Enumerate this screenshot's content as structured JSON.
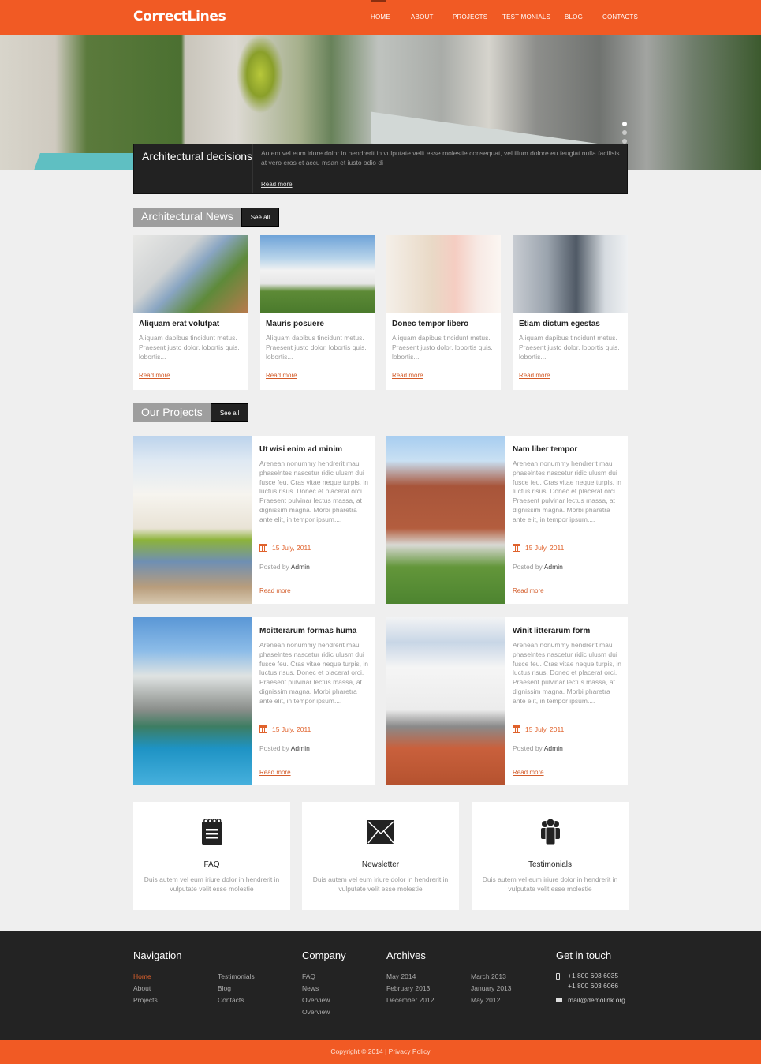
{
  "header": {
    "logo": "CorrectLines",
    "nav": [
      {
        "label": "HOME",
        "active": true
      },
      {
        "label": "ABOUT",
        "active": false
      },
      {
        "label": "PROJECTS",
        "active": false
      },
      {
        "label": "TESTIMONIALS",
        "active": false
      },
      {
        "label": "BLOG",
        "active": false
      },
      {
        "label": "CONTACTS",
        "active": false
      }
    ],
    "accent_color": "#f15a24"
  },
  "slider": {
    "title": "Architectural decisions",
    "text": "Autem vel eum iriure dolor in hendrerit in vulputate velit esse molestie consequat, vel illum dolore eu feugiat nulla facilisis at vero eros et accu msan et iusto odio di",
    "link": "Read more",
    "slide_count": 3,
    "active_slide": 1
  },
  "news": {
    "title": "Architectural News",
    "see_all": "See all",
    "items": [
      {
        "title": "Aliquam erat volutpat",
        "text": "Aliquam dapibus tincidunt metus. Praesent justo dolor, lobortis quis, lobortis...",
        "link": "Read more"
      },
      {
        "title": "Mauris posuere",
        "text": "Aliquam dapibus tincidunt metus. Praesent justo dolor, lobortis quis, lobortis...",
        "link": "Read more"
      },
      {
        "title": "Donec tempor libero",
        "text": "Aliquam dapibus tincidunt metus. Praesent justo dolor, lobortis quis, lobortis...",
        "link": "Read more"
      },
      {
        "title": "Etiam dictum egestas",
        "text": "Aliquam dapibus tincidunt metus. Praesent justo dolor, lobortis quis, lobortis...",
        "link": "Read more"
      }
    ]
  },
  "projects": {
    "title": "Our Projects",
    "see_all": "See all",
    "items": [
      {
        "title": "Ut wisi enim ad minim",
        "text": "Arenean nonummy hendrerit mau phaselntes nascetur ridic ulusm dui fusce feu. Cras vitae neque turpis, in luctus risus. Donec et placerat orci. Praesent pulvinar lectus massa, at dignissim magna. Morbi pharetra ante elit, in tempor ipsum....",
        "date": "15 July, 2011",
        "posted_by": "Posted by",
        "author": "Admin",
        "link": "Read more"
      },
      {
        "title": "Nam liber tempor",
        "text": "Arenean nonummy hendrerit mau phaselntes nascetur ridic ulusm dui fusce feu. Cras vitae neque turpis, in luctus risus. Donec et placerat orci. Praesent pulvinar lectus massa, at dignissim magna. Morbi pharetra ante elit, in tempor ipsum....",
        "date": "15 July, 2011",
        "posted_by": "Posted by",
        "author": "Admin",
        "link": "Read more"
      },
      {
        "title": "Moitterarum formas huma",
        "text": "Arenean nonummy hendrerit mau phaselntes nascetur ridic ulusm dui fusce feu. Cras vitae neque turpis, in luctus risus. Donec et placerat orci. Praesent pulvinar lectus massa, at dignissim magna. Morbi pharetra ante elit, in tempor ipsum....",
        "date": "15 July, 2011",
        "posted_by": "Posted by",
        "author": "Admin",
        "link": "Read more"
      },
      {
        "title": "Winit litterarum form",
        "text": "Arenean nonummy hendrerit mau phaselntes nascetur ridic ulusm dui fusce feu. Cras vitae neque turpis, in luctus risus. Donec et placerat orci. Praesent pulvinar lectus massa, at dignissim magna. Morbi pharetra ante elit, in tempor ipsum....",
        "date": "15 July, 2011",
        "posted_by": "Posted by",
        "author": "Admin",
        "link": "Read more"
      }
    ]
  },
  "features": [
    {
      "icon": "notepad-icon",
      "title": "FAQ",
      "text": "Duis autem vel eum iriure dolor in hendrerit in vulputate velit esse molestie"
    },
    {
      "icon": "envelope-icon",
      "title": "Newsletter",
      "text": "Duis autem vel eum iriure dolor in hendrerit in vulputate velit esse molestie"
    },
    {
      "icon": "people-icon",
      "title": "Testimonials",
      "text": "Duis autem vel eum iriure dolor in hendrerit in vulputate velit esse molestie"
    }
  ],
  "footer": {
    "navigation": {
      "title": "Navigation",
      "col1": [
        "Home",
        "About",
        "Projects"
      ],
      "col2": [
        "Testimonials",
        "Blog",
        "Contacts"
      ]
    },
    "company": {
      "title": "Company",
      "items": [
        "FAQ",
        "News",
        "Overview",
        "Overview"
      ]
    },
    "archives": {
      "title": "Archives",
      "col1": [
        "May 2014",
        "February 2013",
        "December 2012"
      ],
      "col2": [
        "March 2013",
        "January 2013",
        "May 2012"
      ]
    },
    "contact": {
      "title": "Get in touch",
      "phone1": "+1 800 603 6035",
      "phone2": "+1 800 603 6066",
      "email": "mail@demolink.org"
    },
    "copyright": "Copyright © 2014",
    "separator": "|",
    "privacy": "Privacy Policy"
  }
}
